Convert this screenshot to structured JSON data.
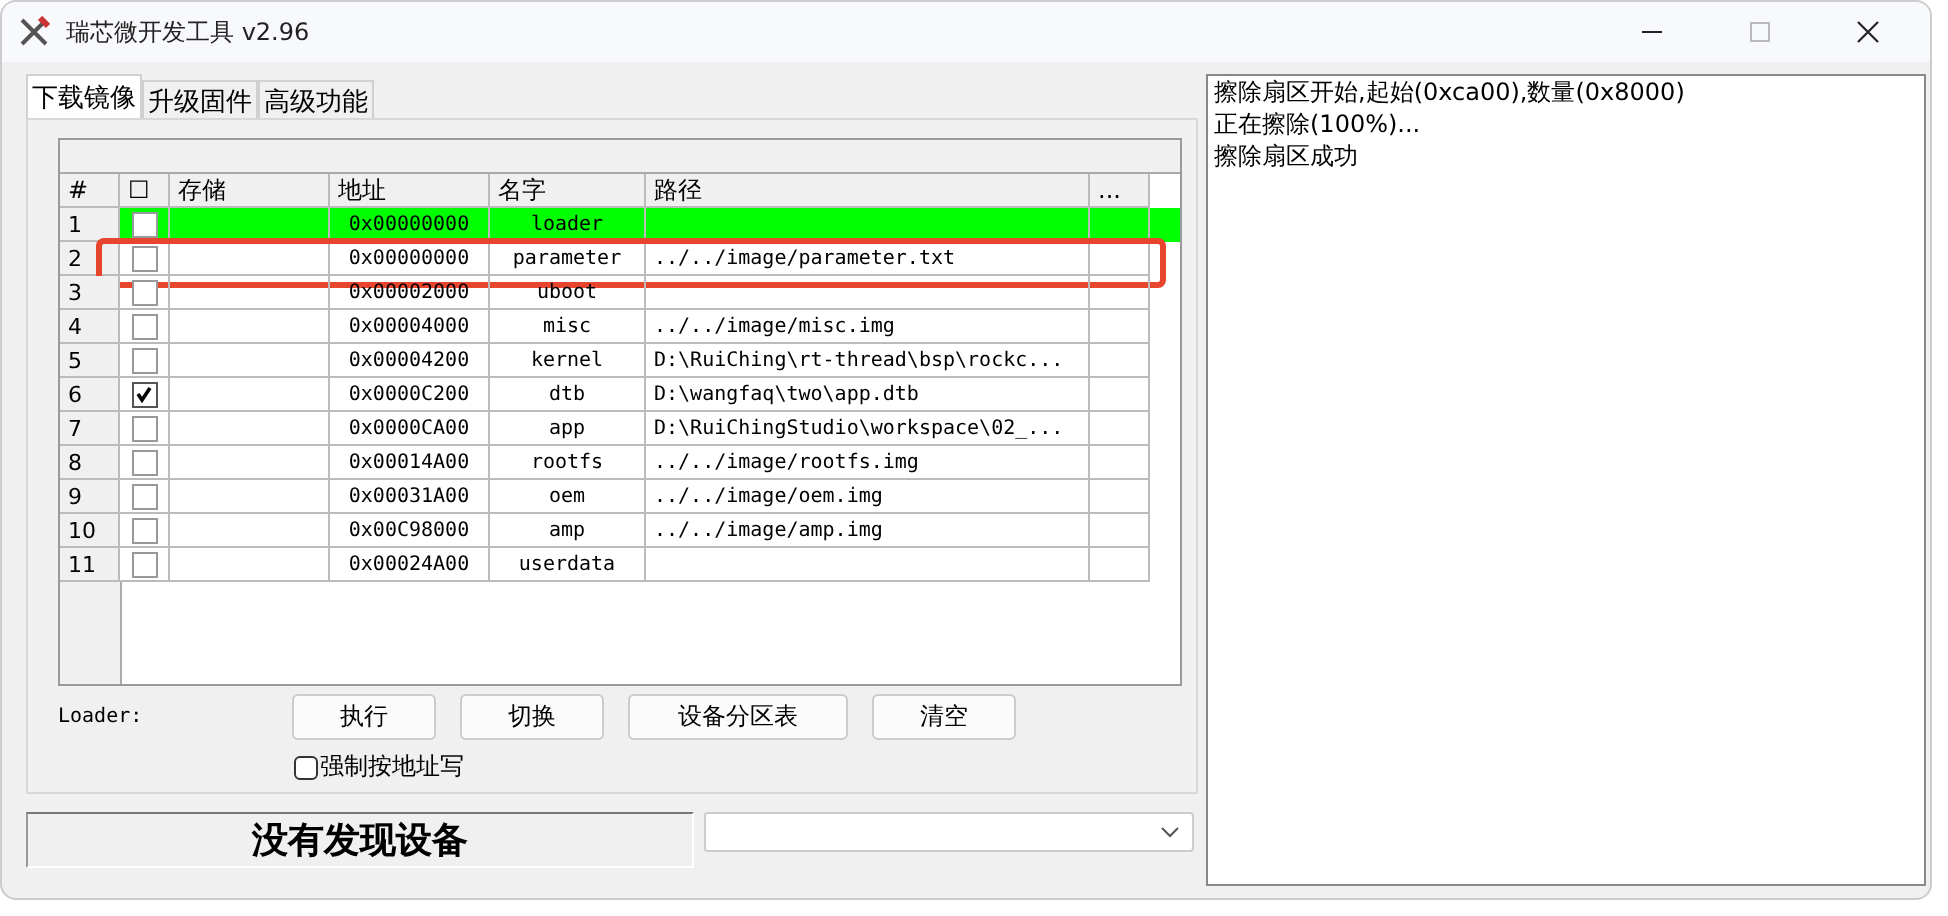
{
  "window": {
    "title": "瑞芯微开发工具 v2.96"
  },
  "tabs": [
    {
      "label": "下载镜像",
      "selected": true
    },
    {
      "label": "升级固件",
      "selected": false
    },
    {
      "label": "高级功能",
      "selected": false
    }
  ],
  "table": {
    "columns": [
      "#",
      "☐",
      "存储",
      "地址",
      "名字",
      "路径",
      "..."
    ],
    "rows": [
      {
        "index": "1",
        "checked": false,
        "address": "0x00000000",
        "name": "loader",
        "path": "",
        "selected": true,
        "highlighted": false
      },
      {
        "index": "2",
        "checked": false,
        "address": "0x00000000",
        "name": "parameter",
        "path": "../../image/parameter.txt",
        "selected": false,
        "highlighted": true
      },
      {
        "index": "3",
        "checked": false,
        "address": "0x00002000",
        "name": "uboot",
        "path": "",
        "selected": false,
        "highlighted": false
      },
      {
        "index": "4",
        "checked": false,
        "address": "0x00004000",
        "name": "misc",
        "path": "../../image/misc.img",
        "selected": false,
        "highlighted": false
      },
      {
        "index": "5",
        "checked": false,
        "address": "0x00004200",
        "name": "kernel",
        "path": "D:\\RuiChing\\rt-thread\\bsp\\rockc...",
        "selected": false,
        "highlighted": false
      },
      {
        "index": "6",
        "checked": true,
        "address": "0x0000C200",
        "name": "dtb",
        "path": "D:\\wangfaq\\two\\app.dtb",
        "selected": false,
        "highlighted": false
      },
      {
        "index": "7",
        "checked": false,
        "address": "0x0000CA00",
        "name": "app",
        "path": "D:\\RuiChingStudio\\workspace\\02_...",
        "selected": false,
        "highlighted": false
      },
      {
        "index": "8",
        "checked": false,
        "address": "0x00014A00",
        "name": "rootfs",
        "path": "../../image/rootfs.img",
        "selected": false,
        "highlighted": false
      },
      {
        "index": "9",
        "checked": false,
        "address": "0x00031A00",
        "name": "oem",
        "path": "../../image/oem.img",
        "selected": false,
        "highlighted": false
      },
      {
        "index": "10",
        "checked": false,
        "address": "0x00C98000",
        "name": "amp",
        "path": "../../image/amp.img",
        "selected": false,
        "highlighted": false
      },
      {
        "index": "11",
        "checked": false,
        "address": "0x00024A00",
        "name": "userdata",
        "path": "",
        "selected": false,
        "highlighted": false
      }
    ]
  },
  "loader_label": "Loader:",
  "buttons": [
    "执行",
    "切换",
    "设备分区表",
    "清空"
  ],
  "force_address": {
    "label": "强制按地址写",
    "checked": false
  },
  "status": "没有发现设备",
  "log": [
    "擦除扇区开始,起始(0xca00),数量(0x8000)",
    "正在擦除(100%)...",
    "擦除扇区成功"
  ]
}
